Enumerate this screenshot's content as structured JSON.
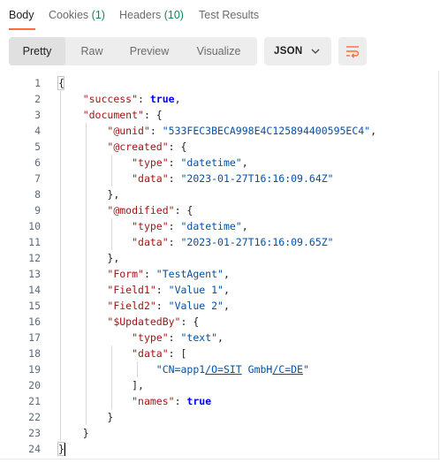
{
  "response_tabs": [
    {
      "label": "Body",
      "count": ""
    },
    {
      "label": "Cookies",
      "count": "(1)"
    },
    {
      "label": "Headers",
      "count": "(10)"
    },
    {
      "label": "Test Results",
      "count": ""
    }
  ],
  "view_modes": [
    "Pretty",
    "Raw",
    "Preview",
    "Visualize"
  ],
  "format_select": {
    "value": "JSON"
  },
  "line_numbers": [
    "1",
    "2",
    "3",
    "4",
    "5",
    "6",
    "7",
    "8",
    "9",
    "10",
    "11",
    "12",
    "13",
    "14",
    "15",
    "16",
    "17",
    "18",
    "19",
    "20",
    "21",
    "22",
    "23",
    "24"
  ],
  "json_text": {
    "success_key": "\"success\"",
    "success_val": "true",
    "document_key": "\"document\"",
    "unid_key": "\"@unid\"",
    "unid_val": "\"533FEC3BECA998E4C125894400595EC4\"",
    "created_key": "\"@created\"",
    "created_type_key": "\"type\"",
    "created_type_val": "\"datetime\"",
    "created_data_key": "\"data\"",
    "created_data_val": "\"2023-01-27T16:16:09.64Z\"",
    "modified_key": "\"@modified\"",
    "modified_type_key": "\"type\"",
    "modified_type_val": "\"datetime\"",
    "modified_data_key": "\"data\"",
    "modified_data_val": "\"2023-01-27T16:16:09.65Z\"",
    "form_key": "\"Form\"",
    "form_val": "\"TestAgent\"",
    "field1_key": "\"Field1\"",
    "field1_val": "\"Value 1\"",
    "field2_key": "\"Field2\"",
    "field2_val": "\"Value 2\"",
    "updatedby_key": "\"$UpdatedBy\"",
    "ub_type_key": "\"type\"",
    "ub_type_val": "\"text\"",
    "ub_data_key": "\"data\"",
    "ub_item_pre": "\"CN=app1",
    "ub_item_link1": "/O=SIT",
    "ub_item_mid": " GmbH",
    "ub_item_link2": "/C=DE",
    "ub_item_post": "\"",
    "ub_names_key": "\"names\"",
    "ub_names_val": "true"
  }
}
